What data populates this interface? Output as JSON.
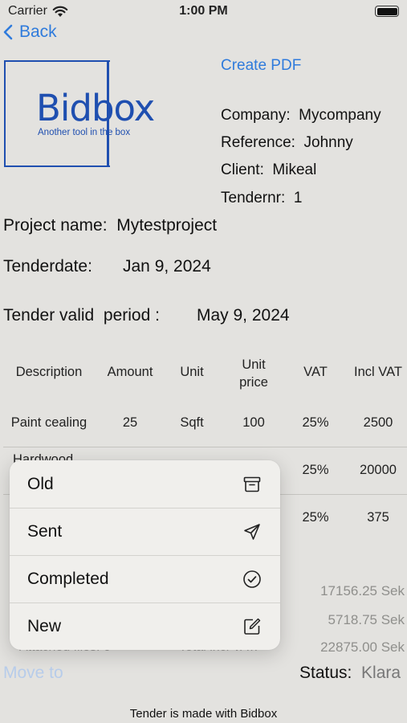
{
  "status_bar": {
    "carrier": "Carrier",
    "time": "1:00 PM"
  },
  "nav": {
    "back_label": "Back",
    "create_pdf_label": "Create PDF"
  },
  "logo": {
    "title": "Bidbox",
    "tagline": "Another tool in the box"
  },
  "info": {
    "company_label": "Company:",
    "company_value": "Mycompany",
    "reference_label": "Reference:",
    "reference_value": "Johnny",
    "client_label": "Client:",
    "client_value": "Mikeal",
    "tendernr_label": "Tendernr:",
    "tendernr_value": "1"
  },
  "project": {
    "name_label": "Project name:",
    "name_value": "Mytestproject",
    "tenderdate_label": "Tenderdate:",
    "tenderdate_value": "Jan 9, 2024",
    "valid_label": "Tender valid  period :",
    "valid_value": "May 9, 2024"
  },
  "table": {
    "headers": [
      "Description",
      "Amount",
      "Unit",
      "Unit\nprice",
      "VAT",
      "Incl VAT"
    ],
    "rows": [
      [
        "Paint cealing",
        "25",
        "Sqft",
        "100",
        "25%",
        "2500"
      ],
      [
        "Hardwood",
        "",
        "",
        "",
        "25%",
        "20000"
      ],
      [
        "",
        "",
        "",
        "",
        "25%",
        "375"
      ]
    ]
  },
  "totals": [
    "17156.25 Sek",
    "5718.75 Sek",
    "22875.00 Sek"
  ],
  "obscured": {
    "attached_files": "Attached files:  0",
    "total_vat": "Total incl VAT:"
  },
  "menu": {
    "items": [
      {
        "label": "Old",
        "icon": "archive-icon"
      },
      {
        "label": "Sent",
        "icon": "paper-plane-icon"
      },
      {
        "label": "Completed",
        "icon": "checkmark-circle-icon"
      },
      {
        "label": "New",
        "icon": "compose-icon"
      }
    ]
  },
  "bottom": {
    "move_to_label": "Move to",
    "status_label": "Status:",
    "status_value": "Klara",
    "footer": "Tender is made with Bidbox"
  },
  "colors": {
    "accent": "#2f7bdc",
    "logo": "#1f4fb0",
    "background": "#e3e2df"
  }
}
